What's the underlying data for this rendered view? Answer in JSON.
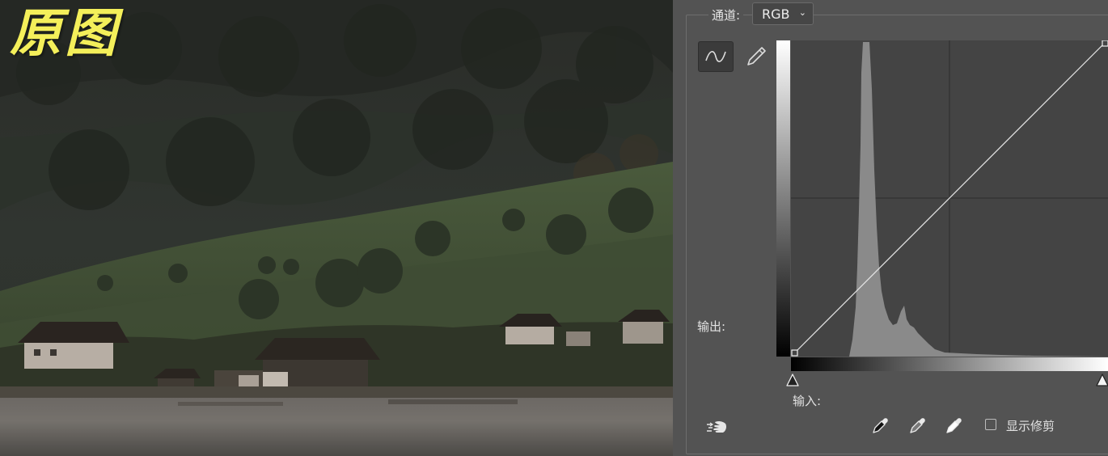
{
  "photo": {
    "label": "原图"
  },
  "curves": {
    "channel_label": "通道:",
    "channel_value": "RGB",
    "output_label": "输出:",
    "input_label": "输入:",
    "show_clipping_label": "显示修剪",
    "show_clipping_checked": false,
    "tools": {
      "curve_tool": "curve-icon",
      "pencil_tool": "pencil-icon",
      "on_image_tool": "hand-adjust-icon"
    },
    "droppers": [
      "eyedropper-black-icon",
      "eyedropper-gray-icon",
      "eyedropper-white-icon"
    ],
    "curve_points": [
      [
        0,
        0
      ],
      [
        255,
        255
      ]
    ]
  },
  "colors": {
    "label_yellow": "#f4ef5a",
    "panel_bg": "#535353",
    "graph_bg": "#444444",
    "histogram": "#8a8a8a"
  }
}
